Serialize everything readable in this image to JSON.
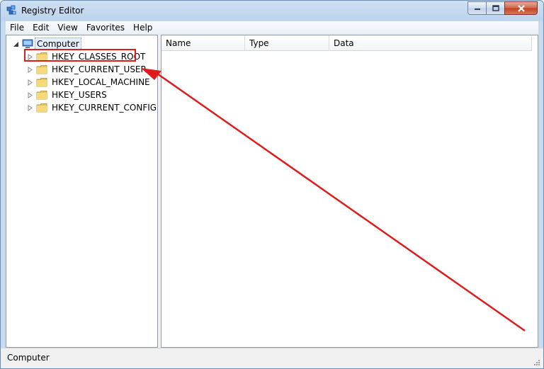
{
  "window": {
    "title": "Registry Editor"
  },
  "menu": [
    "File",
    "Edit",
    "View",
    "Favorites",
    "Help"
  ],
  "tree": {
    "root": "Computer",
    "hives": [
      "HKEY_CLASSES_ROOT",
      "HKEY_CURRENT_USER",
      "HKEY_LOCAL_MACHINE",
      "HKEY_USERS",
      "HKEY_CURRENT_CONFIG"
    ]
  },
  "list": {
    "columns": [
      "Name",
      "Type",
      "Data"
    ]
  },
  "status": {
    "text": "Computer"
  },
  "colors": {
    "annotation": "#e01b1b",
    "titlebar": "#bcd3ec",
    "folder": "#e8c25a"
  },
  "icons": [
    "registry-editor-icon",
    "computer-icon",
    "folder-icon",
    "minimize-icon",
    "maximize-icon",
    "close-icon"
  ]
}
